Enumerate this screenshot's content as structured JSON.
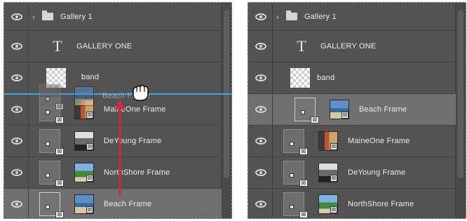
{
  "left_panel": {
    "rows": [
      {
        "name": "Gallery 1",
        "kind": "group"
      },
      {
        "name": "GALLERY ONE",
        "kind": "text"
      },
      {
        "name": "band",
        "kind": "raster"
      },
      {
        "name": "MaineOne Frame",
        "kind": "frame",
        "photo": "maine"
      },
      {
        "name": "DeYoung Frame",
        "kind": "frame",
        "photo": "deyoung"
      },
      {
        "name": "NorthShore Frame",
        "kind": "frame",
        "photo": "north"
      },
      {
        "name": "Beach Frame",
        "kind": "frame",
        "photo": "beach",
        "selected": true
      }
    ],
    "drag_ghost_label": "Beach Frame"
  },
  "right_panel": {
    "rows": [
      {
        "name": "Gallery 1",
        "kind": "group"
      },
      {
        "name": "GALLERY ONE",
        "kind": "text"
      },
      {
        "name": "band",
        "kind": "raster"
      },
      {
        "name": "Beach Frame",
        "kind": "frame",
        "photo": "beach",
        "selected": true
      },
      {
        "name": "MaineOne Frame",
        "kind": "frame",
        "photo": "maine"
      },
      {
        "name": "DeYoung Frame",
        "kind": "frame",
        "photo": "deyoung"
      },
      {
        "name": "NorthShore Frame",
        "kind": "frame",
        "photo": "north"
      }
    ]
  },
  "icons": {
    "visibility": "eye-icon",
    "expand": "chevron-right-icon",
    "group": "folder-icon",
    "text_layer": "type-t-icon",
    "frame": "frame-icon",
    "drag": "grab-hand-icon"
  },
  "colors": {
    "panel_bg": "#535353",
    "selected_row": "#6f6f6f",
    "drop_indicator": "#3fa6e6",
    "drag_arrow": "#d6283a"
  }
}
